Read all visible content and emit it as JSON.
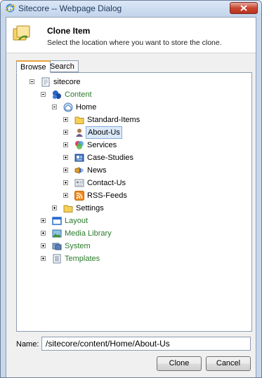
{
  "window": {
    "title": "Sitecore -- Webpage Dialog"
  },
  "header": {
    "title": "Clone Item",
    "description": "Select the location where you want to store the clone."
  },
  "tabs": [
    {
      "label": "Browse"
    },
    {
      "label": "Search"
    }
  ],
  "tree": {
    "root": "sitecore",
    "content": "Content",
    "home": "Home",
    "standard_items": "Standard-Items",
    "about_us": "About-Us",
    "services": "Services",
    "case_studies": "Case-Studies",
    "news": "News",
    "contact_us": "Contact-Us",
    "rss_feeds": "RSS-Feeds",
    "settings": "Settings",
    "layout": "Layout",
    "media_library": "Media Library",
    "system": "System",
    "templates": "Templates"
  },
  "name_field": {
    "label": "Name:",
    "value": "/sitecore/content/Home/About-Us"
  },
  "buttons": {
    "clone": "Clone",
    "cancel": "Cancel"
  },
  "colors": {
    "green_label": "#2b7a2b",
    "selection": "#dbe9f8",
    "tab_accent": "#e8a238"
  }
}
